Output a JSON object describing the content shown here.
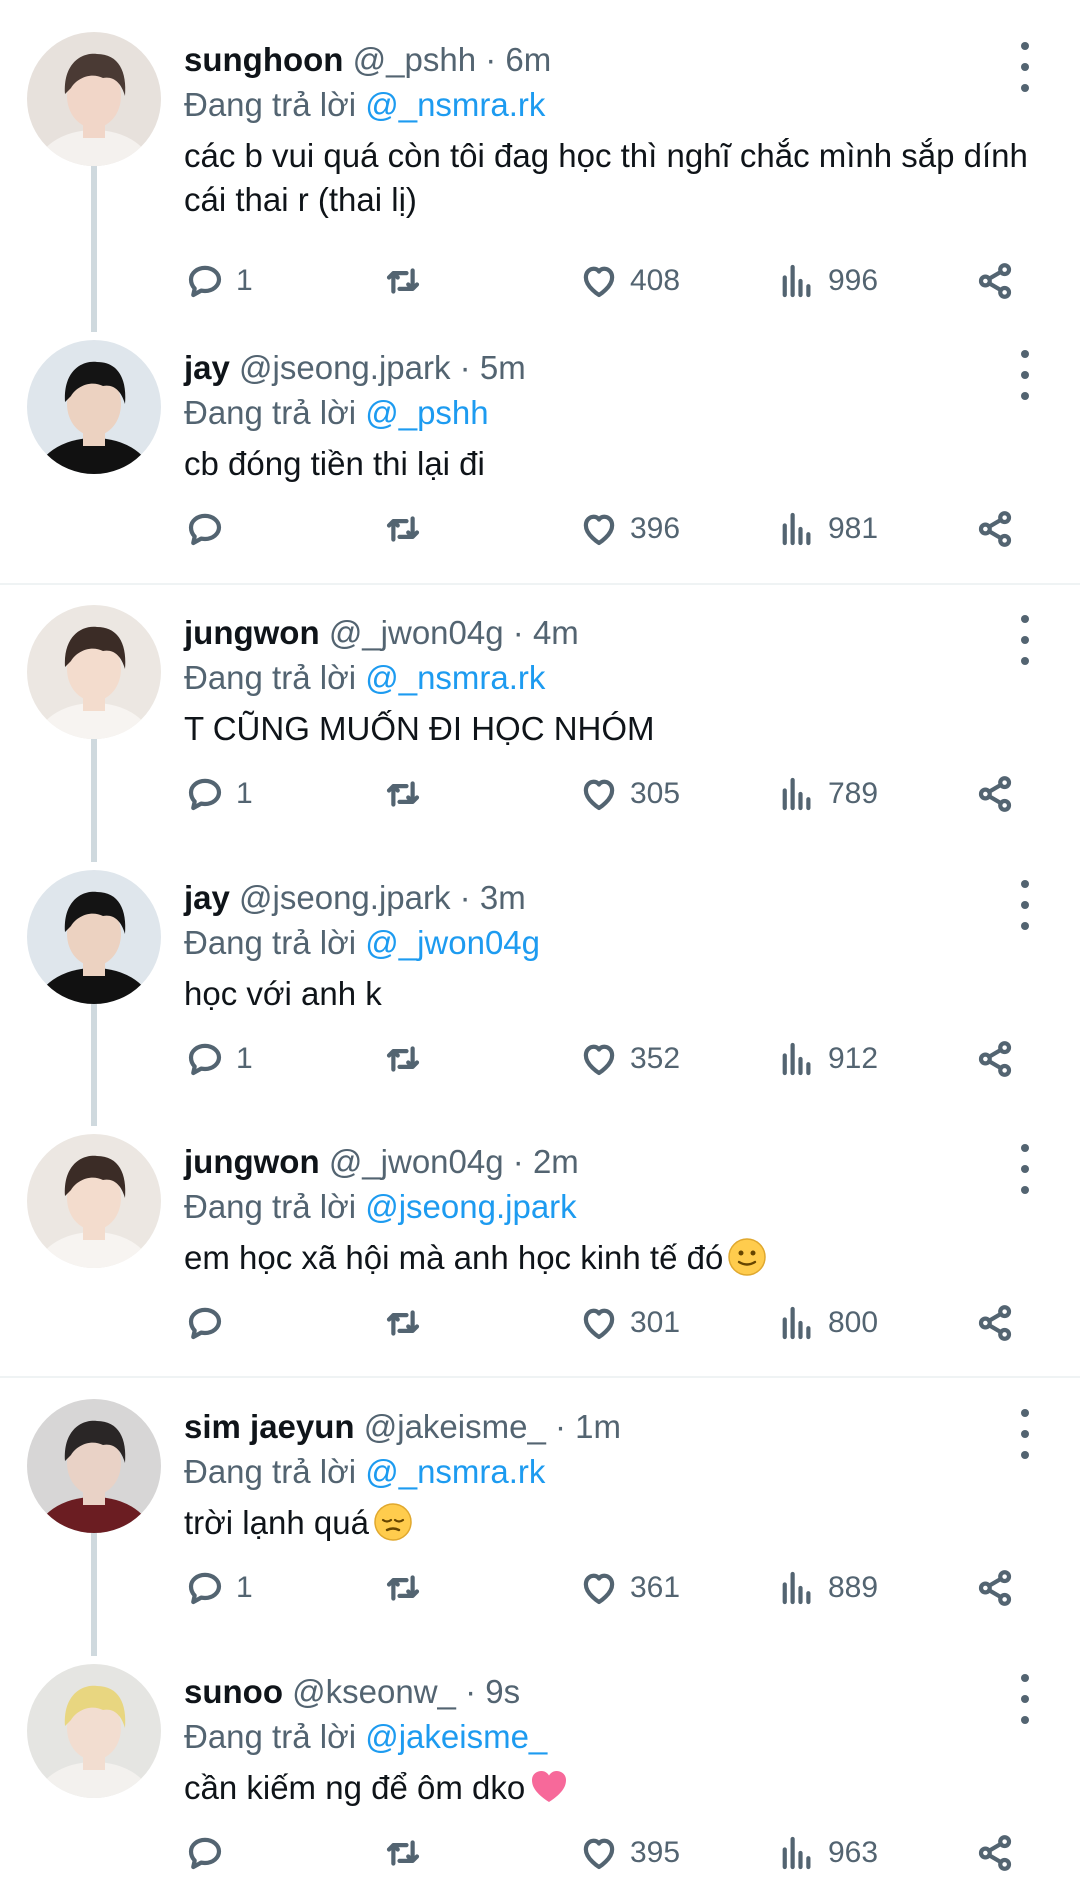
{
  "tweets": [
    {
      "name": "sunghoon",
      "handle": "@_pshh",
      "dot": "·",
      "time": "6m",
      "reply_prefix": "Đang trả lời",
      "reply_to": "@_nsmra.rk",
      "text": "các b vui quá còn tôi đag học thì nghĩ chắc mình sắp dính cái thai r (thai lị)",
      "replies": "1",
      "likes": "408",
      "views": "996",
      "avatar": {
        "bg": "#e7e1dc",
        "hair": "#4a3a34",
        "skin": "#f1d6c8",
        "shirt": "#f4f1ee"
      }
    },
    {
      "name": "jay",
      "handle": "@jseong.jpark",
      "dot": "·",
      "time": "5m",
      "reply_prefix": "Đang trả lời",
      "reply_to": "@_pshh",
      "text": "cb đóng tiền thi lại đi",
      "replies": "",
      "likes": "396",
      "views": "981",
      "avatar": {
        "bg": "#dfe6ec",
        "hair": "#141414",
        "skin": "#ecd2c1",
        "shirt": "#111111"
      }
    },
    {
      "name": "jungwon",
      "handle": "@_jwon04g",
      "dot": "·",
      "time": "4m",
      "reply_prefix": "Đang trả lời",
      "reply_to": "@_nsmra.rk",
      "text": "T CŨNG MUỐN ĐI HỌC NHÓM",
      "replies": "1",
      "likes": "305",
      "views": "789",
      "avatar": {
        "bg": "#ece7e2",
        "hair": "#3b2c26",
        "skin": "#f3dccd",
        "shirt": "#f7f4f1"
      }
    },
    {
      "name": "jay",
      "handle": "@jseong.jpark",
      "dot": "·",
      "time": "3m",
      "reply_prefix": "Đang trả lời",
      "reply_to": "@_jwon04g",
      "text": "học với anh k",
      "replies": "1",
      "likes": "352",
      "views": "912",
      "avatar": {
        "bg": "#dfe6ec",
        "hair": "#141414",
        "skin": "#ecd2c1",
        "shirt": "#111111"
      }
    },
    {
      "name": "jungwon",
      "handle": "@_jwon04g",
      "dot": "·",
      "time": "2m",
      "reply_prefix": "Đang trả lời",
      "reply_to": "@jseong.jpark",
      "text": "em học xã hội mà anh học kinh tế đó",
      "emoji": "slight-smile",
      "replies": "",
      "likes": "301",
      "views": "800",
      "avatar": {
        "bg": "#ece7e2",
        "hair": "#3b2c26",
        "skin": "#f3dccd",
        "shirt": "#f7f4f1"
      }
    },
    {
      "name": "sim jaeyun",
      "handle": "@jakeisme_",
      "dot": "·",
      "time": "1m",
      "reply_prefix": "Đang trả lời",
      "reply_to": "@_nsmra.rk",
      "text": "trời lạnh quá",
      "emoji": "pensive",
      "replies": "1",
      "likes": "361",
      "views": "889",
      "avatar": {
        "bg": "#d7d6d6",
        "hair": "#2a2626",
        "skin": "#e9d2c6",
        "shirt": "#6b1d22"
      }
    },
    {
      "name": "sunoo",
      "handle": "@kseonw_",
      "dot": "·",
      "time": "9s",
      "reply_prefix": "Đang trả lời",
      "reply_to": "@jakeisme_",
      "text": "cần kiếm ng để ôm dko",
      "emoji": "pink-heart",
      "replies": "",
      "likes": "395",
      "views": "963",
      "avatar": {
        "bg": "#e5e5e2",
        "hair": "#e8d680",
        "skin": "#f2ddd0",
        "shirt": "#f3f1ee"
      }
    }
  ],
  "colors": {
    "text": "#0f1419",
    "secondary": "#536471",
    "mention": "#1d9bf0",
    "thread_line": "#cfd9de",
    "separator": "#eff3f4"
  }
}
